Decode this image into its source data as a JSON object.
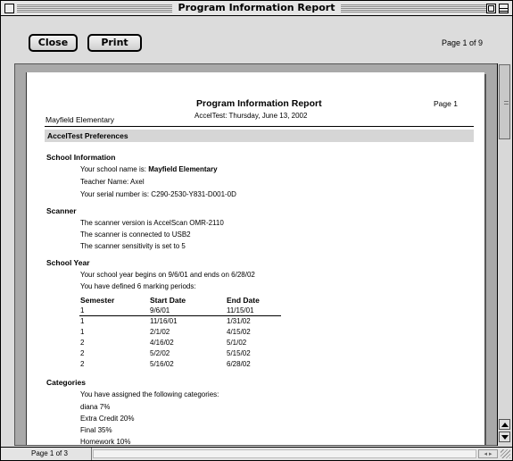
{
  "window": {
    "title": "Program Information Report"
  },
  "toolbar": {
    "close_label": "Close",
    "print_label": "Print",
    "page_indicator": "Page 1 of 9"
  },
  "report": {
    "title": "Program Information Report",
    "subtitle": "AccelTest: Thursday, June 13, 2002",
    "page_label": "Page 1",
    "school_name": "Mayfield Elementary",
    "band_heading": "AccelTest Preferences",
    "school_info": {
      "heading": "School Information",
      "lines": [
        {
          "prefix": "Your school name is: ",
          "value": "Mayfield Elementary"
        },
        {
          "prefix": "Teacher Name: Axel",
          "value": ""
        },
        {
          "prefix": "Your serial number is: C290-2530-Y831-D001-0D",
          "value": ""
        }
      ]
    },
    "scanner": {
      "heading": "Scanner",
      "lines": [
        "The scanner version is AccelScan OMR-2110",
        "The scanner is connected to USB2",
        "The scanner sensitivity is set to 5"
      ]
    },
    "school_year": {
      "heading": "School Year",
      "lines": [
        "Your school year begins on 9/6/01 and ends on 6/28/02",
        "You have defined 6 marking periods:"
      ],
      "columns": [
        "Semester",
        "Start Date",
        "End Date"
      ],
      "rows": [
        [
          "1",
          "9/6/01",
          "11/15/01"
        ],
        [
          "1",
          "11/16/01",
          "1/31/02"
        ],
        [
          "1",
          "2/1/02",
          "4/15/02"
        ],
        [
          "2",
          "4/16/02",
          "5/1/02"
        ],
        [
          "2",
          "5/2/02",
          "5/15/02"
        ],
        [
          "2",
          "5/16/02",
          "6/28/02"
        ]
      ]
    },
    "categories": {
      "heading": "Categories",
      "intro": "You have assigned the following categories:",
      "items": [
        "diana 7%",
        "Extra Credit 20%",
        "Final 35%",
        "Homework 10%"
      ]
    }
  },
  "statusbar": {
    "page_count": "Page 1 of 3"
  }
}
